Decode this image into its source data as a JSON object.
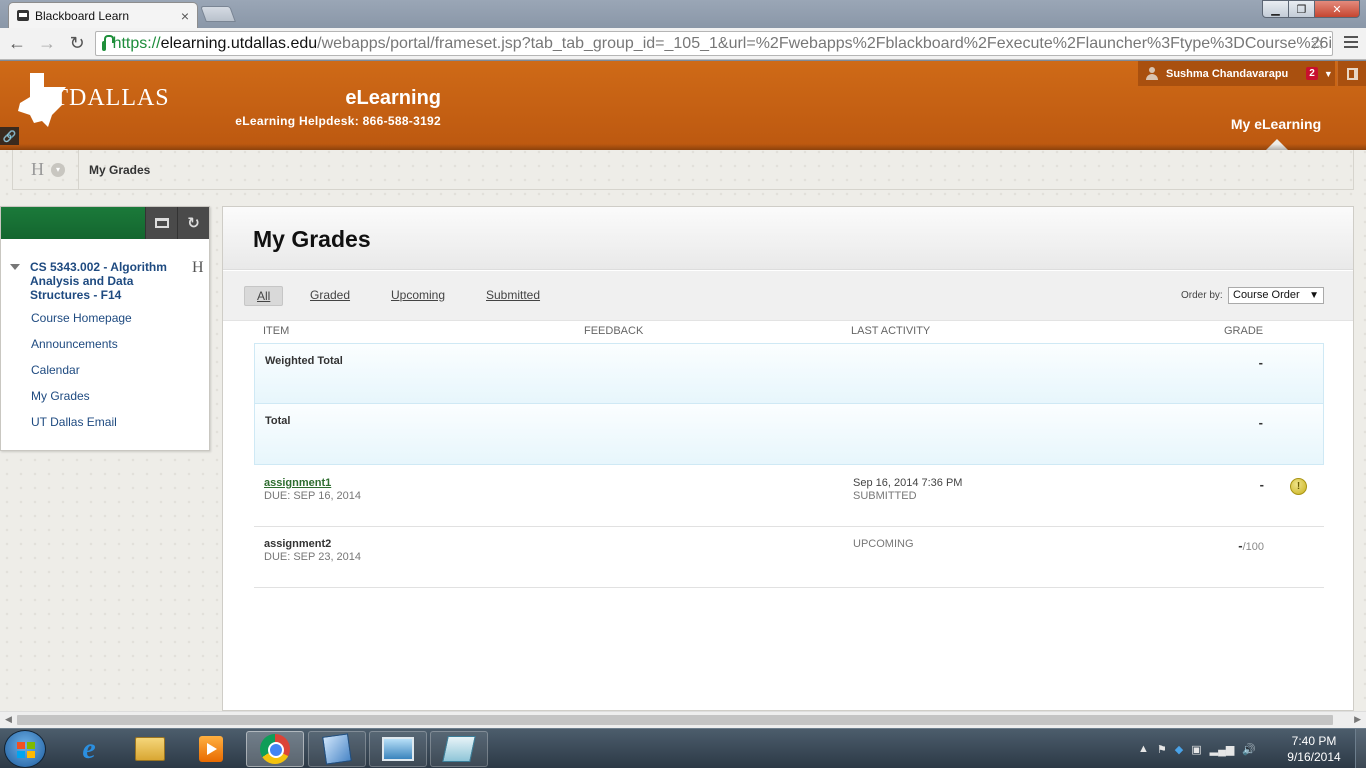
{
  "browser": {
    "tab_title": "Blackboard Learn",
    "tab_close": "×",
    "url_scheme": "https://",
    "url_host": "elearning.utdallas.edu",
    "url_path": "/webapps/portal/frameset.jsp?tab_tab_group_id=_105_1&url=%2Fwebapps%2Fblackboard%2Fexecute%2Flauncher%3Ftype%3DCourse%26i",
    "back": "←",
    "forward": "→",
    "reload": "↻",
    "star": "☆",
    "win_min": "▁",
    "win_max": "❐",
    "win_close": "✕"
  },
  "header": {
    "logo_text": "UTDALLAS",
    "brand_title": "eLearning",
    "helpdesk": "eLearning Helpdesk: 866-588-3192",
    "user_name": "Sushma Chandavarapu",
    "notification_count": "2",
    "caret": "▼",
    "active_tab": "My eLearning",
    "pin": "🔗"
  },
  "breadcrumb": {
    "home_icon": "H",
    "current": "My Grades"
  },
  "sidebar": {
    "course_title": "CS 5343.002 - Algorithm Analysis and Data Structures - F14",
    "h_icon": "H",
    "links": [
      {
        "label": "Course Homepage"
      },
      {
        "label": "Announcements"
      },
      {
        "label": "Calendar"
      },
      {
        "label": "My Grades"
      },
      {
        "label": "UT Dallas Email"
      }
    ],
    "refresh_icon": "↻"
  },
  "main": {
    "title": "My Grades",
    "filters": [
      {
        "label": "All",
        "active": true
      },
      {
        "label": "Graded"
      },
      {
        "label": "Upcoming"
      },
      {
        "label": "Submitted"
      }
    ],
    "order_label": "Order by:",
    "order_value": "Course Order",
    "order_arrow": "▼",
    "columns": {
      "item": "ITEM",
      "feedback": "FEEDBACK",
      "last_activity": "LAST ACTIVITY",
      "grade": "GRADE"
    },
    "rows": [
      {
        "name": "Weighted Total",
        "due": "",
        "activity": "",
        "status": "",
        "grade": "-",
        "out_of": ""
      },
      {
        "name": "Total",
        "due": "",
        "activity": "",
        "status": "",
        "grade": "-",
        "out_of": ""
      },
      {
        "name": "assignment1",
        "due": "DUE: SEP 16, 2014",
        "activity": "Sep 16, 2014 7:36 PM",
        "status": "SUBMITTED",
        "grade": "-",
        "out_of": "",
        "icon": "!"
      },
      {
        "name": "assignment2",
        "due": "DUE: SEP 23, 2014",
        "activity": "",
        "status": "UPCOMING",
        "grade": "-",
        "out_of": "/100"
      }
    ]
  },
  "scrollbar": {
    "left": "◀",
    "right": "▶"
  },
  "taskbar": {
    "time": "7:40 PM",
    "date": "9/16/2014",
    "tray_arrow": "▲",
    "tray_flag": "⚑",
    "tray_signal": "▂▄▆",
    "tray_volume": "🔊",
    "ie_letter": "e"
  },
  "colors": {
    "header_orange": "#c8611a",
    "sidebar_green": "#1b7a3a",
    "link_blue": "#1e4a80",
    "assignment_link_green": "#2e6d2f"
  }
}
